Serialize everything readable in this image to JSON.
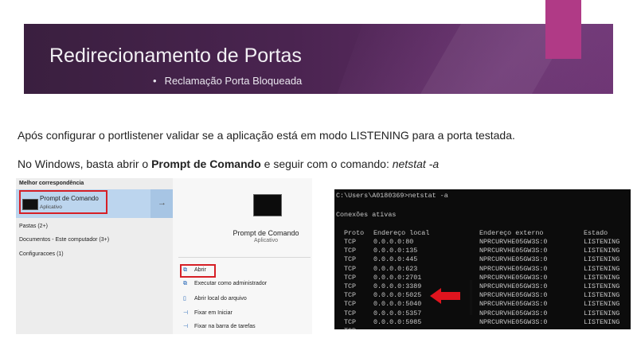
{
  "slide": {
    "title": "Redirecionamento de Portas",
    "subtitle": "Reclamação Porta Bloqueada",
    "bullet": "•",
    "para1": "Após configurar o portlistener validar se a aplicação está em modo LISTENING para a porta testada.",
    "para2_prefix": "No Windows, basta abrir o ",
    "para2_bold": "Prompt de Comando",
    "para2_mid": " e seguir com o comando: ",
    "para2_italic": "netstat -a",
    "colors": {
      "banner": "#4a2450",
      "accent_pink": "#b03a86",
      "highlight_red": "#d61f26"
    }
  },
  "search_panel": {
    "header": "Melhor correspondência",
    "best_match": {
      "name": "Prompt de Comando",
      "type": "Aplicativo",
      "icon": "cmd-icon"
    },
    "arrow": "→",
    "sections": [
      "Pastas (2+)",
      "Documentos - Este computador (3+)",
      "Configuracoes (1)"
    ],
    "detail": {
      "name": "Prompt de Comando",
      "type": "Aplicativo"
    },
    "actions": [
      {
        "label": "Abrir",
        "icon": "open-icon",
        "glyph": "⧉"
      },
      {
        "label": "Executar como administrador",
        "icon": "admin-icon",
        "glyph": "⧉"
      },
      {
        "label": "Abrir local do arquivo",
        "icon": "folder-icon",
        "glyph": "▯"
      },
      {
        "label": "Fixar em Iniciar",
        "icon": "pin-icon",
        "glyph": "⊣"
      },
      {
        "label": "Fixar na barra de tarefas",
        "icon": "pin-taskbar-icon",
        "glyph": "⊣"
      }
    ]
  },
  "console": {
    "prompt": "C:\\Users\\A0180369>netstat -a",
    "heading": "Conexões ativas",
    "columns": [
      "Proto",
      "Endereço local",
      "Endereço externo",
      "Estado"
    ],
    "rows": [
      [
        "TCP",
        "0.0.0.0:80",
        "NPRCURVHE05GW3S:0",
        "LISTENING"
      ],
      [
        "TCP",
        "0.0.0.0:135",
        "NPRCURVHE05GW3S:0",
        "LISTENING"
      ],
      [
        "TCP",
        "0.0.0.0:445",
        "NPRCURVHE05GW3S:0",
        "LISTENING"
      ],
      [
        "TCP",
        "0.0.0.0:623",
        "NPRCURVHE05GW3S:0",
        "LISTENING"
      ],
      [
        "TCP",
        "0.0.0.0:2701",
        "NPRCURVHE05GW3S:0",
        "LISTENING"
      ],
      [
        "TCP",
        "0.0.0.0:3389",
        "NPRCURVHE05GW3S:0",
        "LISTENING"
      ],
      [
        "TCP",
        "0.0.0.0:5025",
        "NPRCURVHE05GW3S:0",
        "LISTENING"
      ],
      [
        "TCP",
        "0.0.0.0:5040",
        "NPRCURVHE05GW3S:0",
        "LISTENING"
      ],
      [
        "TCP",
        "0.0.0.0:5357",
        "NPRCURVHE05GW3S:0",
        "LISTENING"
      ],
      [
        "TCP",
        "0.0.0.0:5985",
        "NPRCURVHE05GW3S:0",
        "LISTENING"
      ],
      [
        "TCP",
        "",
        "",
        ""
      ]
    ]
  }
}
